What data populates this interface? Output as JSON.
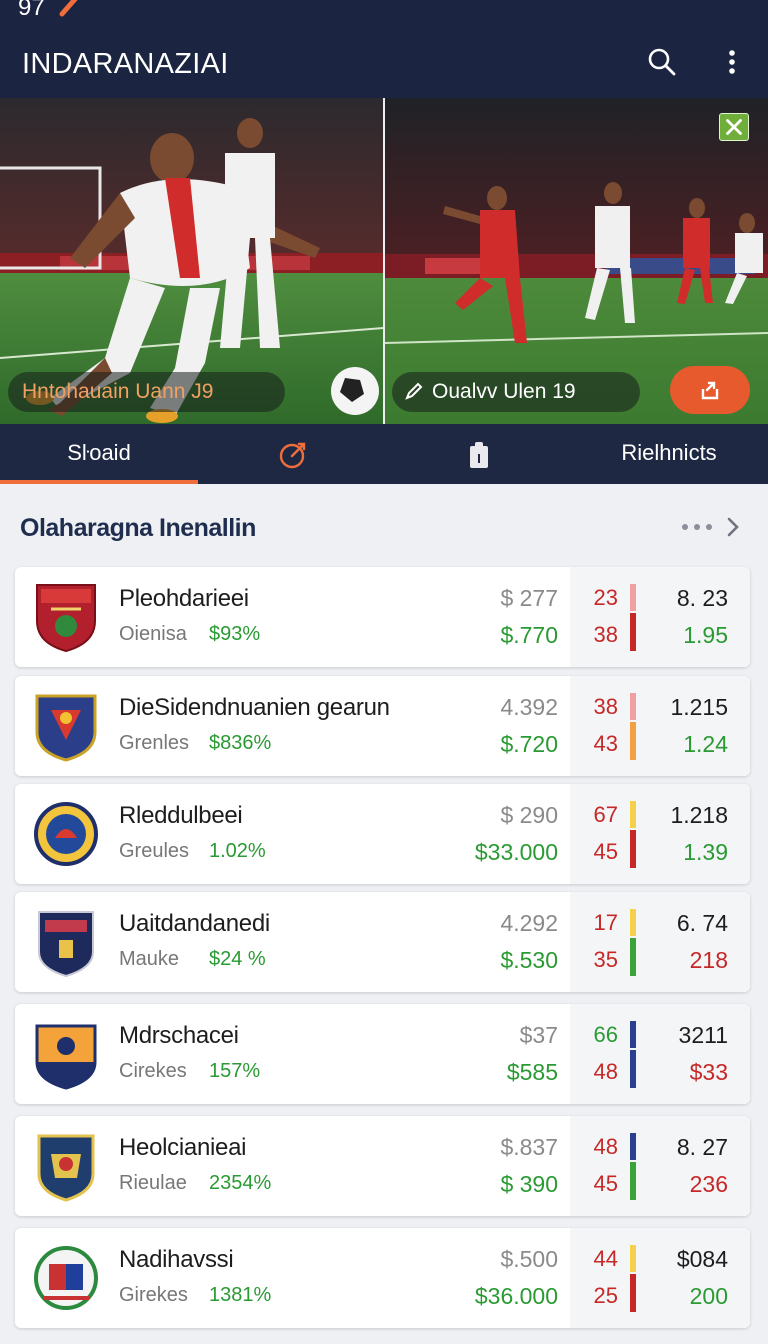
{
  "status_bar": {
    "time": "97"
  },
  "app_bar": {
    "title": "INDARANAZIAI",
    "icons": [
      "search-icon",
      "more-vertical-icon"
    ]
  },
  "hero": {
    "left_caption": "Hntohauain Uann J9",
    "right_caption": "Oualvv Ulen 19",
    "icons": [
      "pen-icon",
      "share-icon",
      "close-icon"
    ],
    "accent_color": "#e65a2d"
  },
  "tabs": [
    {
      "label": "Sŀoaid",
      "active": true
    },
    {
      "icon": "target-icon"
    },
    {
      "icon": "clipboard-icon"
    },
    {
      "label": "Rielhnicts"
    }
  ],
  "section": {
    "title": "Olaharagna Inenallin",
    "icons": [
      "dots-horizontal-icon",
      "chevron-right-icon"
    ]
  },
  "teams": [
    {
      "name": "Pleohdarieei",
      "subtitle": "Oienisa",
      "change": "$93%",
      "price": "$ 277",
      "value": "$.770",
      "stat_top": "23",
      "stat_bottom": "38",
      "stat_top_color": "#c62828",
      "stat_bottom_color": "#c62828",
      "bar_top_color": "#f0a0a0",
      "bar_bottom_color": "#c62828",
      "right_top": "8. 23",
      "right_bottom": "1.95",
      "right_bottom_color": "#2a9a33"
    },
    {
      "name": "DieSidendnuanien gearun",
      "subtitle": "Grenles",
      "change": "$836%",
      "price": "4.392",
      "value": "$.720",
      "stat_top": "38",
      "stat_bottom": "43",
      "stat_top_color": "#c62828",
      "stat_bottom_color": "#c62828",
      "bar_top_color": "#f0a0a0",
      "bar_bottom_color": "#f3a045",
      "right_top": "1.215",
      "right_bottom": "1.24",
      "right_bottom_color": "#2a9a33"
    },
    {
      "name": "Rleddulbeei",
      "subtitle": "Greules",
      "change": "1.02%",
      "price": "$ 290",
      "value": "$33.000",
      "stat_top": "67",
      "stat_bottom": "45",
      "stat_top_color": "#c62828",
      "stat_bottom_color": "#c62828",
      "bar_top_color": "#f5d04a",
      "bar_bottom_color": "#c62828",
      "right_top": "1.218",
      "right_bottom": "1.39",
      "right_bottom_color": "#2a9a33"
    },
    {
      "name": "Uaitdandanedi",
      "subtitle": "Mauke",
      "change": "$24 %",
      "price": "4.292",
      "value": "$.530",
      "stat_top": "17",
      "stat_bottom": "35",
      "stat_top_color": "#c62828",
      "stat_bottom_color": "#c62828",
      "bar_top_color": "#f5d04a",
      "bar_bottom_color": "#3aa33a",
      "right_top": "6. 74",
      "right_bottom": "218",
      "right_bottom_color": "#c62828"
    },
    {
      "name": "Mdrschacei",
      "subtitle": "Cirekes",
      "change": "157%",
      "price": "$37",
      "value": "$585",
      "stat_top": "66",
      "stat_bottom": "48",
      "stat_top_color": "#2a9a33",
      "stat_bottom_color": "#c62828",
      "bar_top_color": "#2a3f8f",
      "bar_bottom_color": "#2a3f8f",
      "right_top": "3211",
      "right_bottom": "$33",
      "right_bottom_color": "#c62828"
    },
    {
      "name": "Heolcianieai",
      "subtitle": "Rieulae",
      "change": "2354%",
      "price": "$.837",
      "value": "$ 390",
      "stat_top": "48",
      "stat_bottom": "45",
      "stat_top_color": "#c62828",
      "stat_bottom_color": "#c62828",
      "bar_top_color": "#2a3f8f",
      "bar_bottom_color": "#3aa33a",
      "right_top": "8. 27",
      "right_bottom": "236",
      "right_bottom_color": "#c62828"
    },
    {
      "name": "Nadihavssi",
      "subtitle": "Girekes",
      "change": "1381%",
      "price": "$.500",
      "value": "$36.000",
      "stat_top": "44",
      "stat_bottom": "25",
      "stat_top_color": "#c62828",
      "stat_bottom_color": "#c62828",
      "bar_top_color": "#f5d04a",
      "bar_bottom_color": "#c62828",
      "right_top": "$084",
      "right_bottom": "200",
      "right_bottom_color": "#2a9a33"
    }
  ]
}
